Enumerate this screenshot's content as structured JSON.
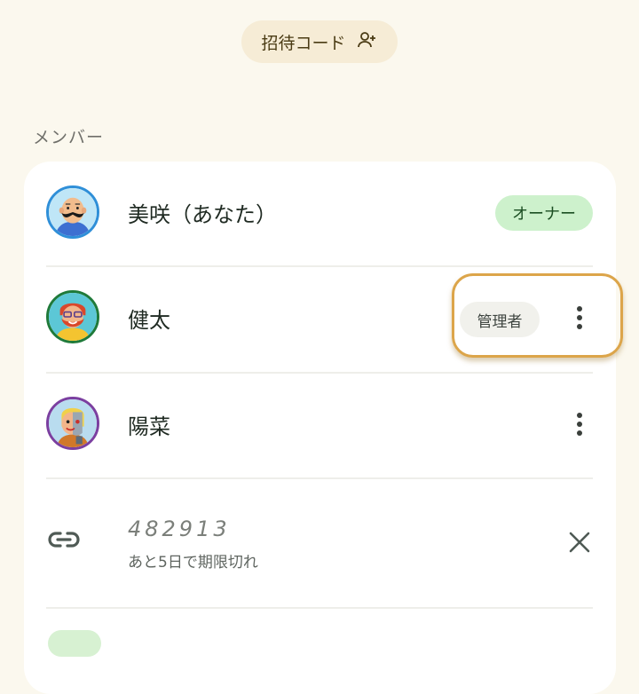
{
  "invite": {
    "label": "招待コード",
    "icon": "person-add-icon"
  },
  "members_section": {
    "label": "メンバー",
    "members": [
      {
        "name": "美咲（あなた）",
        "role_badge": "オーナー",
        "avatar": "bald-mustache-avatar",
        "ring_color": "#2f8fd8"
      },
      {
        "name": "健太",
        "role_badge": "管理者",
        "avatar": "red-beard-glasses-avatar",
        "ring_color": "#1f7a3a"
      },
      {
        "name": "陽菜",
        "role_badge": "",
        "avatar": "cyborg-avatar",
        "ring_color": "#7b3fa0"
      }
    ],
    "invite_code": {
      "code": "482913",
      "expiry": "あと5日で期限切れ",
      "icon": "link-icon",
      "close_icon": "close-icon"
    }
  },
  "colors": {
    "background": "#fbf8ee",
    "card": "#ffffff",
    "owner_badge": "#cdf1cc",
    "highlight": "#dca54a"
  }
}
